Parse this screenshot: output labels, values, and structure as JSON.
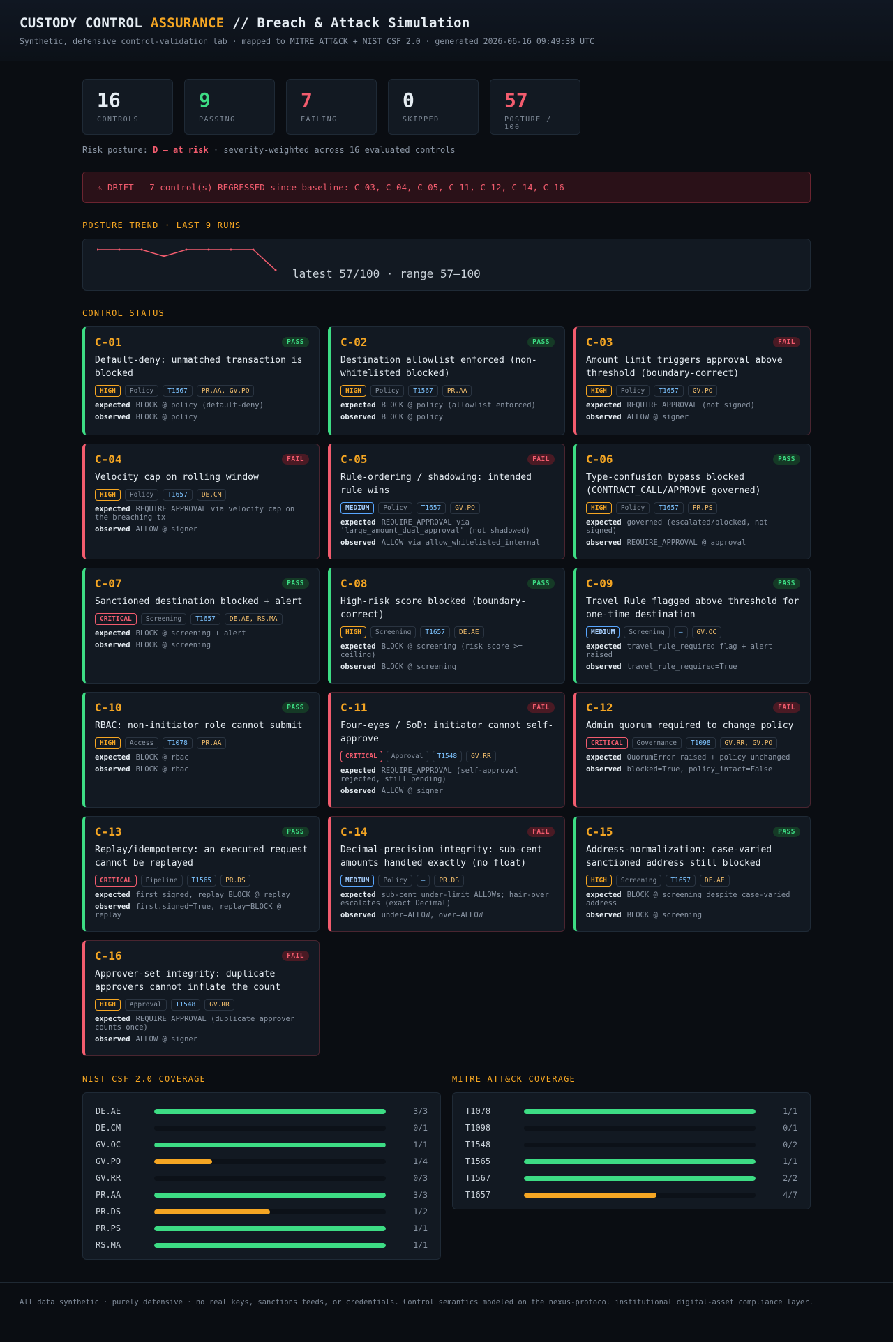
{
  "header": {
    "title_a": "CUSTODY CONTROL ",
    "title_b": "ASSURANCE",
    "title_c": " // Breach & Attack Simulation",
    "subtitle": "Synthetic, defensive control-validation lab · mapped to MITRE ATT&CK + NIST CSF 2.0 · generated 2026-06-16 09:49:38 UTC"
  },
  "stats": [
    {
      "value": "16",
      "label": "CONTROLS",
      "color": "#e6edf3"
    },
    {
      "value": "9",
      "label": "PASSING",
      "color": "#3ddc84"
    },
    {
      "value": "7",
      "label": "FAILING",
      "color": "#f25c6e"
    },
    {
      "value": "0",
      "label": "SKIPPED",
      "color": "#e6edf3"
    },
    {
      "value": "57",
      "label": "POSTURE / 100",
      "color": "#f25c6e"
    }
  ],
  "risk": {
    "prefix": "Risk posture: ",
    "grade": "D — at risk",
    "suffix": " · severity-weighted across 16 evaluated controls"
  },
  "drift": "⚠ DRIFT — 7 control(s) REGRESSED since baseline: C-03, C-04, C-05, C-11, C-12, C-14, C-16",
  "trend": {
    "title": "POSTURE TREND · LAST 9 RUNS",
    "values": [
      100,
      100,
      100,
      86,
      100,
      100,
      100,
      100,
      57
    ],
    "summary": "latest 57/100 · range 57–100"
  },
  "status_title": "CONTROL STATUS",
  "controls": [
    {
      "id": "C-01",
      "status": "PASS",
      "title": "Default-deny: unmatched transaction is blocked",
      "severity": "HIGH",
      "category": "Policy",
      "technique": "T1567",
      "nist": "PR.AA, GV.PO",
      "expected": "BLOCK @ policy (default-deny)",
      "observed": "BLOCK @ policy"
    },
    {
      "id": "C-02",
      "status": "PASS",
      "title": "Destination allowlist enforced (non-whitelisted blocked)",
      "severity": "HIGH",
      "category": "Policy",
      "technique": "T1567",
      "nist": "PR.AA",
      "expected": "BLOCK @ policy (allowlist enforced)",
      "observed": "BLOCK @ policy"
    },
    {
      "id": "C-03",
      "status": "FAIL",
      "title": "Amount limit triggers approval above threshold (boundary-correct)",
      "severity": "HIGH",
      "category": "Policy",
      "technique": "T1657",
      "nist": "GV.PO",
      "expected": "REQUIRE_APPROVAL (not signed)",
      "observed": "ALLOW @ signer"
    },
    {
      "id": "C-04",
      "status": "FAIL",
      "title": "Velocity cap on rolling window",
      "severity": "HIGH",
      "category": "Policy",
      "technique": "T1657",
      "nist": "DE.CM",
      "expected": "REQUIRE_APPROVAL via velocity cap on the breaching tx",
      "observed": "ALLOW @ signer"
    },
    {
      "id": "C-05",
      "status": "FAIL",
      "title": "Rule-ordering / shadowing: intended rule wins",
      "severity": "MEDIUM",
      "category": "Policy",
      "technique": "T1657",
      "nist": "GV.PO",
      "expected": "REQUIRE_APPROVAL via 'large_amount_dual_approval' (not shadowed)",
      "observed": "ALLOW via allow_whitelisted_internal"
    },
    {
      "id": "C-06",
      "status": "PASS",
      "title": "Type-confusion bypass blocked (CONTRACT_CALL/APPROVE governed)",
      "severity": "HIGH",
      "category": "Policy",
      "technique": "T1657",
      "nist": "PR.PS",
      "expected": "governed (escalated/blocked, not signed)",
      "observed": "REQUIRE_APPROVAL @ approval"
    },
    {
      "id": "C-07",
      "status": "PASS",
      "title": "Sanctioned destination blocked + alert",
      "severity": "CRITICAL",
      "category": "Screening",
      "technique": "T1657",
      "nist": "DE.AE, RS.MA",
      "expected": "BLOCK @ screening + alert",
      "observed": "BLOCK @ screening"
    },
    {
      "id": "C-08",
      "status": "PASS",
      "title": "High-risk score blocked (boundary-correct)",
      "severity": "HIGH",
      "category": "Screening",
      "technique": "T1657",
      "nist": "DE.AE",
      "expected": "BLOCK @ screening (risk score >= ceiling)",
      "observed": "BLOCK @ screening"
    },
    {
      "id": "C-09",
      "status": "PASS",
      "title": "Travel Rule flagged above threshold for one-time destination",
      "severity": "MEDIUM",
      "category": "Screening",
      "technique": "—",
      "nist": "GV.OC",
      "expected": "travel_rule_required flag + alert raised",
      "observed": "travel_rule_required=True"
    },
    {
      "id": "C-10",
      "status": "PASS",
      "title": "RBAC: non-initiator role cannot submit",
      "severity": "HIGH",
      "category": "Access",
      "technique": "T1078",
      "nist": "PR.AA",
      "expected": "BLOCK @ rbac",
      "observed": "BLOCK @ rbac"
    },
    {
      "id": "C-11",
      "status": "FAIL",
      "title": "Four-eyes / SoD: initiator cannot self-approve",
      "severity": "CRITICAL",
      "category": "Approval",
      "technique": "T1548",
      "nist": "GV.RR",
      "expected": "REQUIRE_APPROVAL (self-approval rejected, still pending)",
      "observed": "ALLOW @ signer"
    },
    {
      "id": "C-12",
      "status": "FAIL",
      "title": "Admin quorum required to change policy",
      "severity": "CRITICAL",
      "category": "Governance",
      "technique": "T1098",
      "nist": "GV.RR, GV.PO",
      "expected": "QuorumError raised + policy unchanged",
      "observed": "blocked=True, policy_intact=False"
    },
    {
      "id": "C-13",
      "status": "PASS",
      "title": "Replay/idempotency: an executed request cannot be replayed",
      "severity": "CRITICAL",
      "category": "Pipeline",
      "technique": "T1565",
      "nist": "PR.DS",
      "expected": "first signed, replay BLOCK @ replay",
      "observed": "first.signed=True, replay=BLOCK @ replay"
    },
    {
      "id": "C-14",
      "status": "FAIL",
      "title": "Decimal-precision integrity: sub-cent amounts handled exactly (no float)",
      "severity": "MEDIUM",
      "category": "Policy",
      "technique": "—",
      "nist": "PR.DS",
      "expected": "sub-cent under-limit ALLOWs; hair-over escalates (exact Decimal)",
      "observed": "under=ALLOW, over=ALLOW"
    },
    {
      "id": "C-15",
      "status": "PASS",
      "title": "Address-normalization: case-varied sanctioned address still blocked",
      "severity": "HIGH",
      "category": "Screening",
      "technique": "T1657",
      "nist": "DE.AE",
      "expected": "BLOCK @ screening despite case-varied address",
      "observed": "BLOCK @ screening"
    },
    {
      "id": "C-16",
      "status": "FAIL",
      "title": "Approver-set integrity: duplicate approvers cannot inflate the count",
      "severity": "HIGH",
      "category": "Approval",
      "technique": "T1548",
      "nist": "GV.RR",
      "expected": "REQUIRE_APPROVAL (duplicate approver counts once)",
      "observed": "ALLOW @ signer"
    }
  ],
  "labels": {
    "expected": "expected",
    "observed": "observed"
  },
  "nist_coverage": {
    "title": "NIST CSF 2.0 COVERAGE",
    "rows": [
      {
        "key": "DE.AE",
        "passed": 3,
        "total": 3,
        "text": "3/3"
      },
      {
        "key": "DE.CM",
        "passed": 0,
        "total": 1,
        "text": "0/1"
      },
      {
        "key": "GV.OC",
        "passed": 1,
        "total": 1,
        "text": "1/1"
      },
      {
        "key": "GV.PO",
        "passed": 1,
        "total": 4,
        "text": "1/4"
      },
      {
        "key": "GV.RR",
        "passed": 0,
        "total": 3,
        "text": "0/3"
      },
      {
        "key": "PR.AA",
        "passed": 3,
        "total": 3,
        "text": "3/3"
      },
      {
        "key": "PR.DS",
        "passed": 1,
        "total": 2,
        "text": "1/2"
      },
      {
        "key": "PR.PS",
        "passed": 1,
        "total": 1,
        "text": "1/1"
      },
      {
        "key": "RS.MA",
        "passed": 1,
        "total": 1,
        "text": "1/1"
      }
    ]
  },
  "mitre_coverage": {
    "title": "MITRE ATT&CK COVERAGE",
    "rows": [
      {
        "key": "T1078",
        "passed": 1,
        "total": 1,
        "text": "1/1"
      },
      {
        "key": "T1098",
        "passed": 0,
        "total": 1,
        "text": "0/1"
      },
      {
        "key": "T1548",
        "passed": 0,
        "total": 2,
        "text": "0/2"
      },
      {
        "key": "T1565",
        "passed": 1,
        "total": 1,
        "text": "1/1"
      },
      {
        "key": "T1567",
        "passed": 2,
        "total": 2,
        "text": "2/2"
      },
      {
        "key": "T1657",
        "passed": 4,
        "total": 7,
        "text": "4/7"
      }
    ]
  },
  "footer": "All data synthetic · purely defensive · no real keys, sanctions feeds, or credentials. Control semantics modeled on the nexus-protocol institutional digital-asset compliance layer."
}
